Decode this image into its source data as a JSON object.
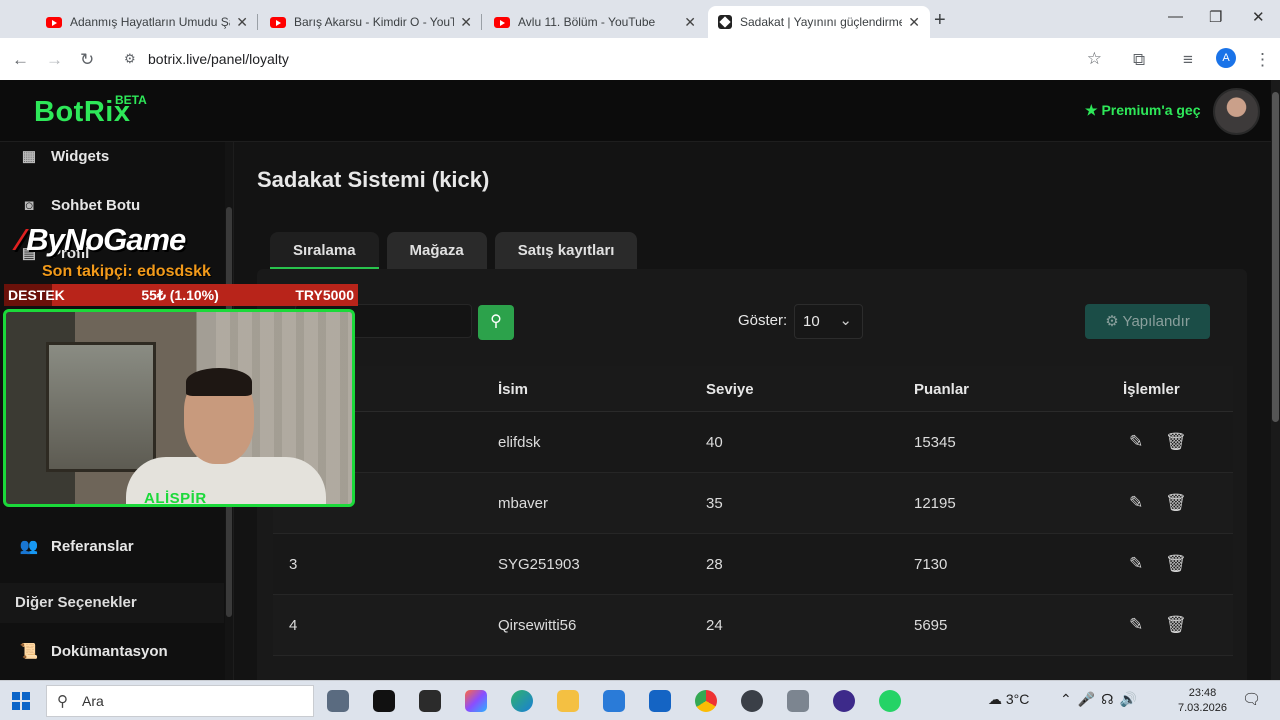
{
  "browser": {
    "tabs": [
      {
        "title": "Adanmış Hayatların Umudu Şar",
        "icon": "youtube-icon"
      },
      {
        "title": "Barış Akarsu - Kimdir O - YouTu",
        "icon": "youtube-icon"
      },
      {
        "title": "Avlu 11. Bölüm - YouTube",
        "icon": "youtube-icon"
      },
      {
        "title": "Sadakat | Yayınını güçlendirmek",
        "icon": "botrix-icon",
        "active": true
      }
    ],
    "url": "botrix.live/panel/loyalty",
    "profile_initial": "A"
  },
  "app": {
    "logo": "BotRix",
    "beta": "BETA",
    "premium": "Premium'a geç",
    "brand_color": "#2ee859"
  },
  "sidebar": {
    "items": [
      {
        "label": "Widgets",
        "icon": "grid-icon"
      },
      {
        "label": "Sohbet Botu",
        "icon": "robot-icon"
      },
      {
        "label": "Profil",
        "icon": "id-card-icon"
      },
      {
        "label": "Referanslar",
        "icon": "users-icon"
      }
    ],
    "section_head": "Diğer Seçenekler",
    "doc_label": "Dokümantasyon"
  },
  "main": {
    "title": "Sadakat Sistemi (kick)",
    "tabs": [
      "Sıralama",
      "Mağaza",
      "Satış kayıtları"
    ],
    "show_label": "Göster:",
    "show_value": "10",
    "configure": "Yapılandır",
    "columns": [
      "İsim",
      "Seviye",
      "Puanlar",
      "İşlemler"
    ],
    "rows": [
      {
        "rank": "",
        "name": "elifdsk",
        "level": "40",
        "points": "15345"
      },
      {
        "rank": "",
        "name": "mbaver",
        "level": "35",
        "points": "12195"
      },
      {
        "rank": "3",
        "name": "SYG251903",
        "level": "28",
        "points": "7130"
      },
      {
        "rank": "4",
        "name": "Qirsewitti56",
        "level": "24",
        "points": "5695"
      }
    ]
  },
  "overlay": {
    "brand": "ByNoGame",
    "follower": "Son takipçi: edosdskk",
    "goal_left": "DESTEK",
    "goal_mid": "55₺ (1.10%)",
    "goal_right": "TRY5000",
    "goal_progress": 0.011,
    "streamer_name": "ALİSPİR"
  },
  "taskbar": {
    "search": "Ara",
    "weather": "3°C",
    "time": "23:48",
    "date": "7.03.2026"
  }
}
